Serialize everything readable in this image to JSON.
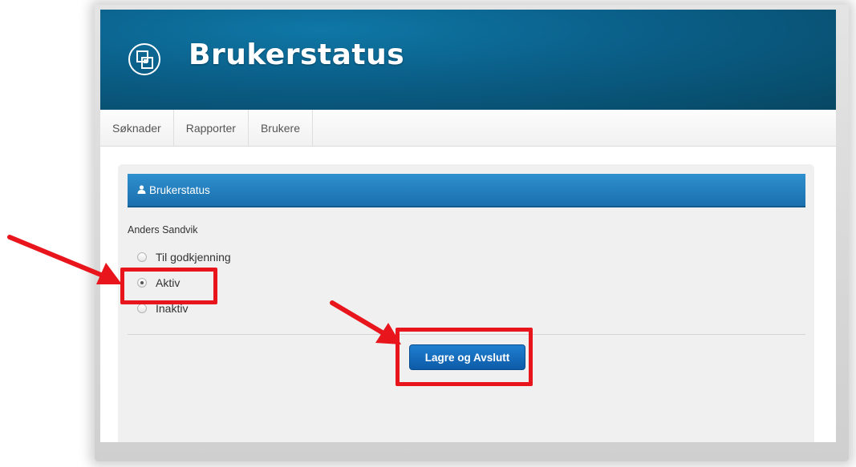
{
  "header": {
    "title": "Brukerstatus",
    "logo_icon": "layers-icon"
  },
  "nav": {
    "items": [
      {
        "label": "Søknader"
      },
      {
        "label": "Rapporter"
      },
      {
        "label": "Brukere"
      }
    ]
  },
  "panel": {
    "heading": "Brukerstatus",
    "heading_icon": "user-icon",
    "user_name": "Anders Sandvik",
    "status_options": [
      {
        "label": "Til godkjenning",
        "checked": false
      },
      {
        "label": "Aktiv",
        "checked": true
      },
      {
        "label": "Inaktiv",
        "checked": false
      }
    ],
    "save_label": "Lagre og Avslutt"
  },
  "annotations": {
    "highlight_color": "#e8161c",
    "highlighted": [
      "status-option-aktiv",
      "save-button"
    ]
  },
  "colors": {
    "header_bg": "#0a5f88",
    "panel_heading_bg": "#2382c4",
    "button_bg": "#1668bb"
  }
}
